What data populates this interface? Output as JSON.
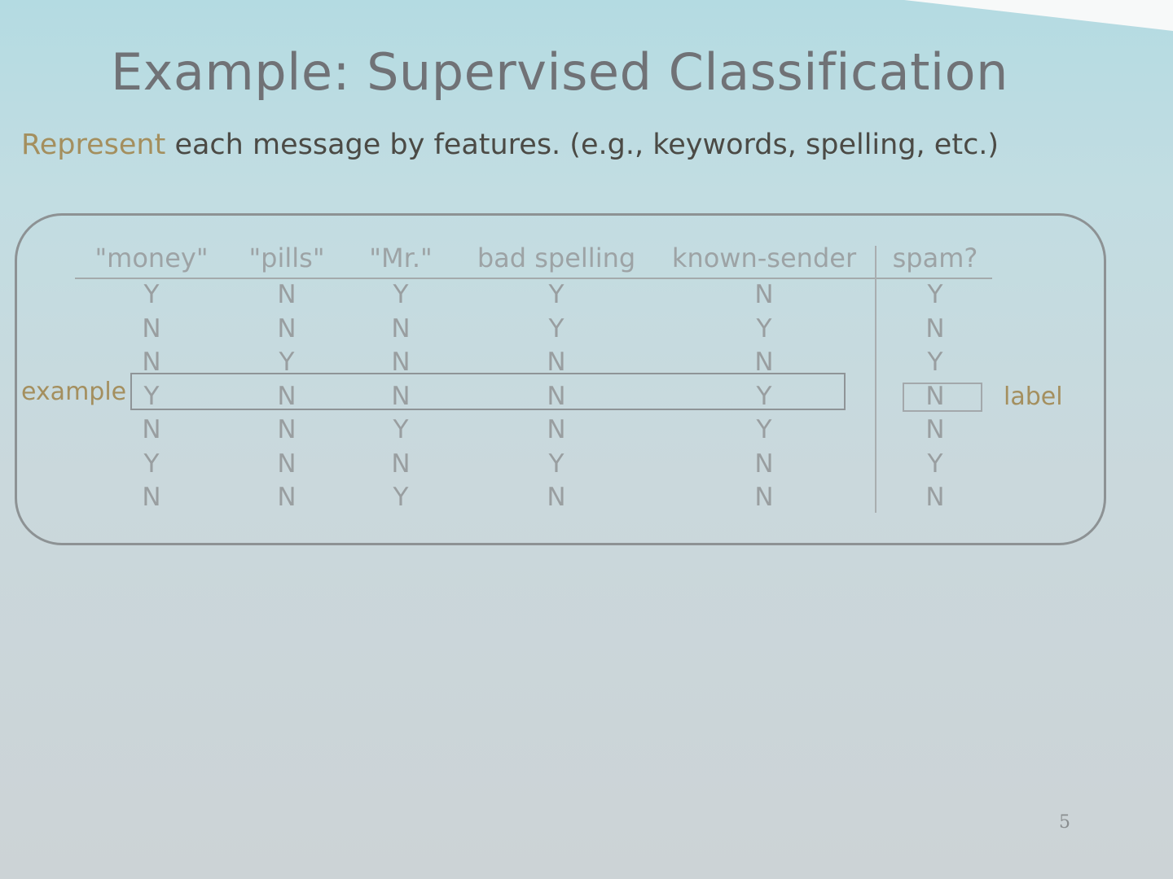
{
  "slide": {
    "title": "Example: Supervised Classification",
    "subtitle_lead": "Represent",
    "subtitle_rest": " each message by features. (e.g., keywords, spelling, etc.)",
    "page_number": "5"
  },
  "table": {
    "headers": [
      "\"money\"",
      "\"pills\"",
      "\"Mr.\"",
      "bad spelling",
      "known-sender",
      "spam?"
    ],
    "rows": [
      [
        "Y",
        "N",
        "Y",
        "Y",
        "N",
        "Y"
      ],
      [
        "N",
        "N",
        "N",
        "Y",
        "Y",
        "N"
      ],
      [
        "N",
        "Y",
        "N",
        "N",
        "N",
        "Y"
      ],
      [
        "Y",
        "N",
        "N",
        "N",
        "Y",
        "N"
      ],
      [
        "N",
        "N",
        "Y",
        "N",
        "Y",
        "N"
      ],
      [
        "Y",
        "N",
        "N",
        "Y",
        "N",
        "Y"
      ],
      [
        "N",
        "N",
        "Y",
        "N",
        "N",
        "N"
      ]
    ],
    "highlighted_row_index": 3
  },
  "annotations": {
    "example_label": "example",
    "label_label": "label"
  },
  "colors": {
    "title": "#707276",
    "accent": "#a48f5e",
    "table_text": "#999ea0",
    "background": "#c2dde2"
  }
}
